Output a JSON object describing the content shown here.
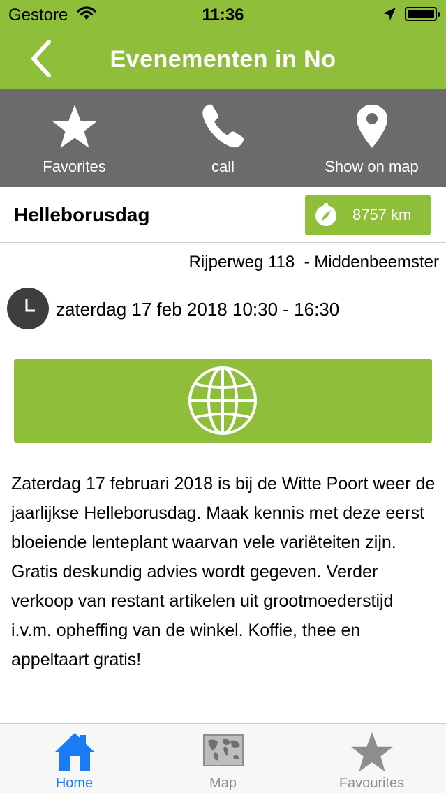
{
  "status_bar": {
    "carrier": "Gestore",
    "time": "11:36"
  },
  "nav": {
    "title": "Evenementen in No"
  },
  "actions": [
    {
      "label": "Favorites",
      "icon": "star-icon"
    },
    {
      "label": "call",
      "icon": "phone-icon"
    },
    {
      "label": "Show on map",
      "icon": "map-pin-icon"
    }
  ],
  "event": {
    "name": "Helleborusdag",
    "distance": "8757 km",
    "address": "Rijperweg 118  - Middenbeemster",
    "datetime": "zaterdag 17 feb 2018 10:30 - 16:30",
    "description": "Zaterdag 17 februari 2018 is bij de Witte Poort weer de jaarlijkse Helleborusdag. Maak kennis met deze eerst bloeiende lenteplant waarvan vele variëteiten zijn. Gratis deskundig advies wordt gegeven. Verder verkoop van restant artikelen uit grootmoederstijd i.v.m. opheffing van de winkel. Koffie, thee en appeltaart gratis!"
  },
  "tabs": [
    {
      "label": "Home",
      "icon": "home-icon",
      "active": true
    },
    {
      "label": "Map",
      "icon": "world-map-icon",
      "active": false
    },
    {
      "label": "Favourites",
      "icon": "star-icon",
      "active": false
    }
  ],
  "colors": {
    "brand_green": "#8fbe3a",
    "action_bar": "#6b6b6b",
    "tab_active": "#1a7cf5"
  }
}
